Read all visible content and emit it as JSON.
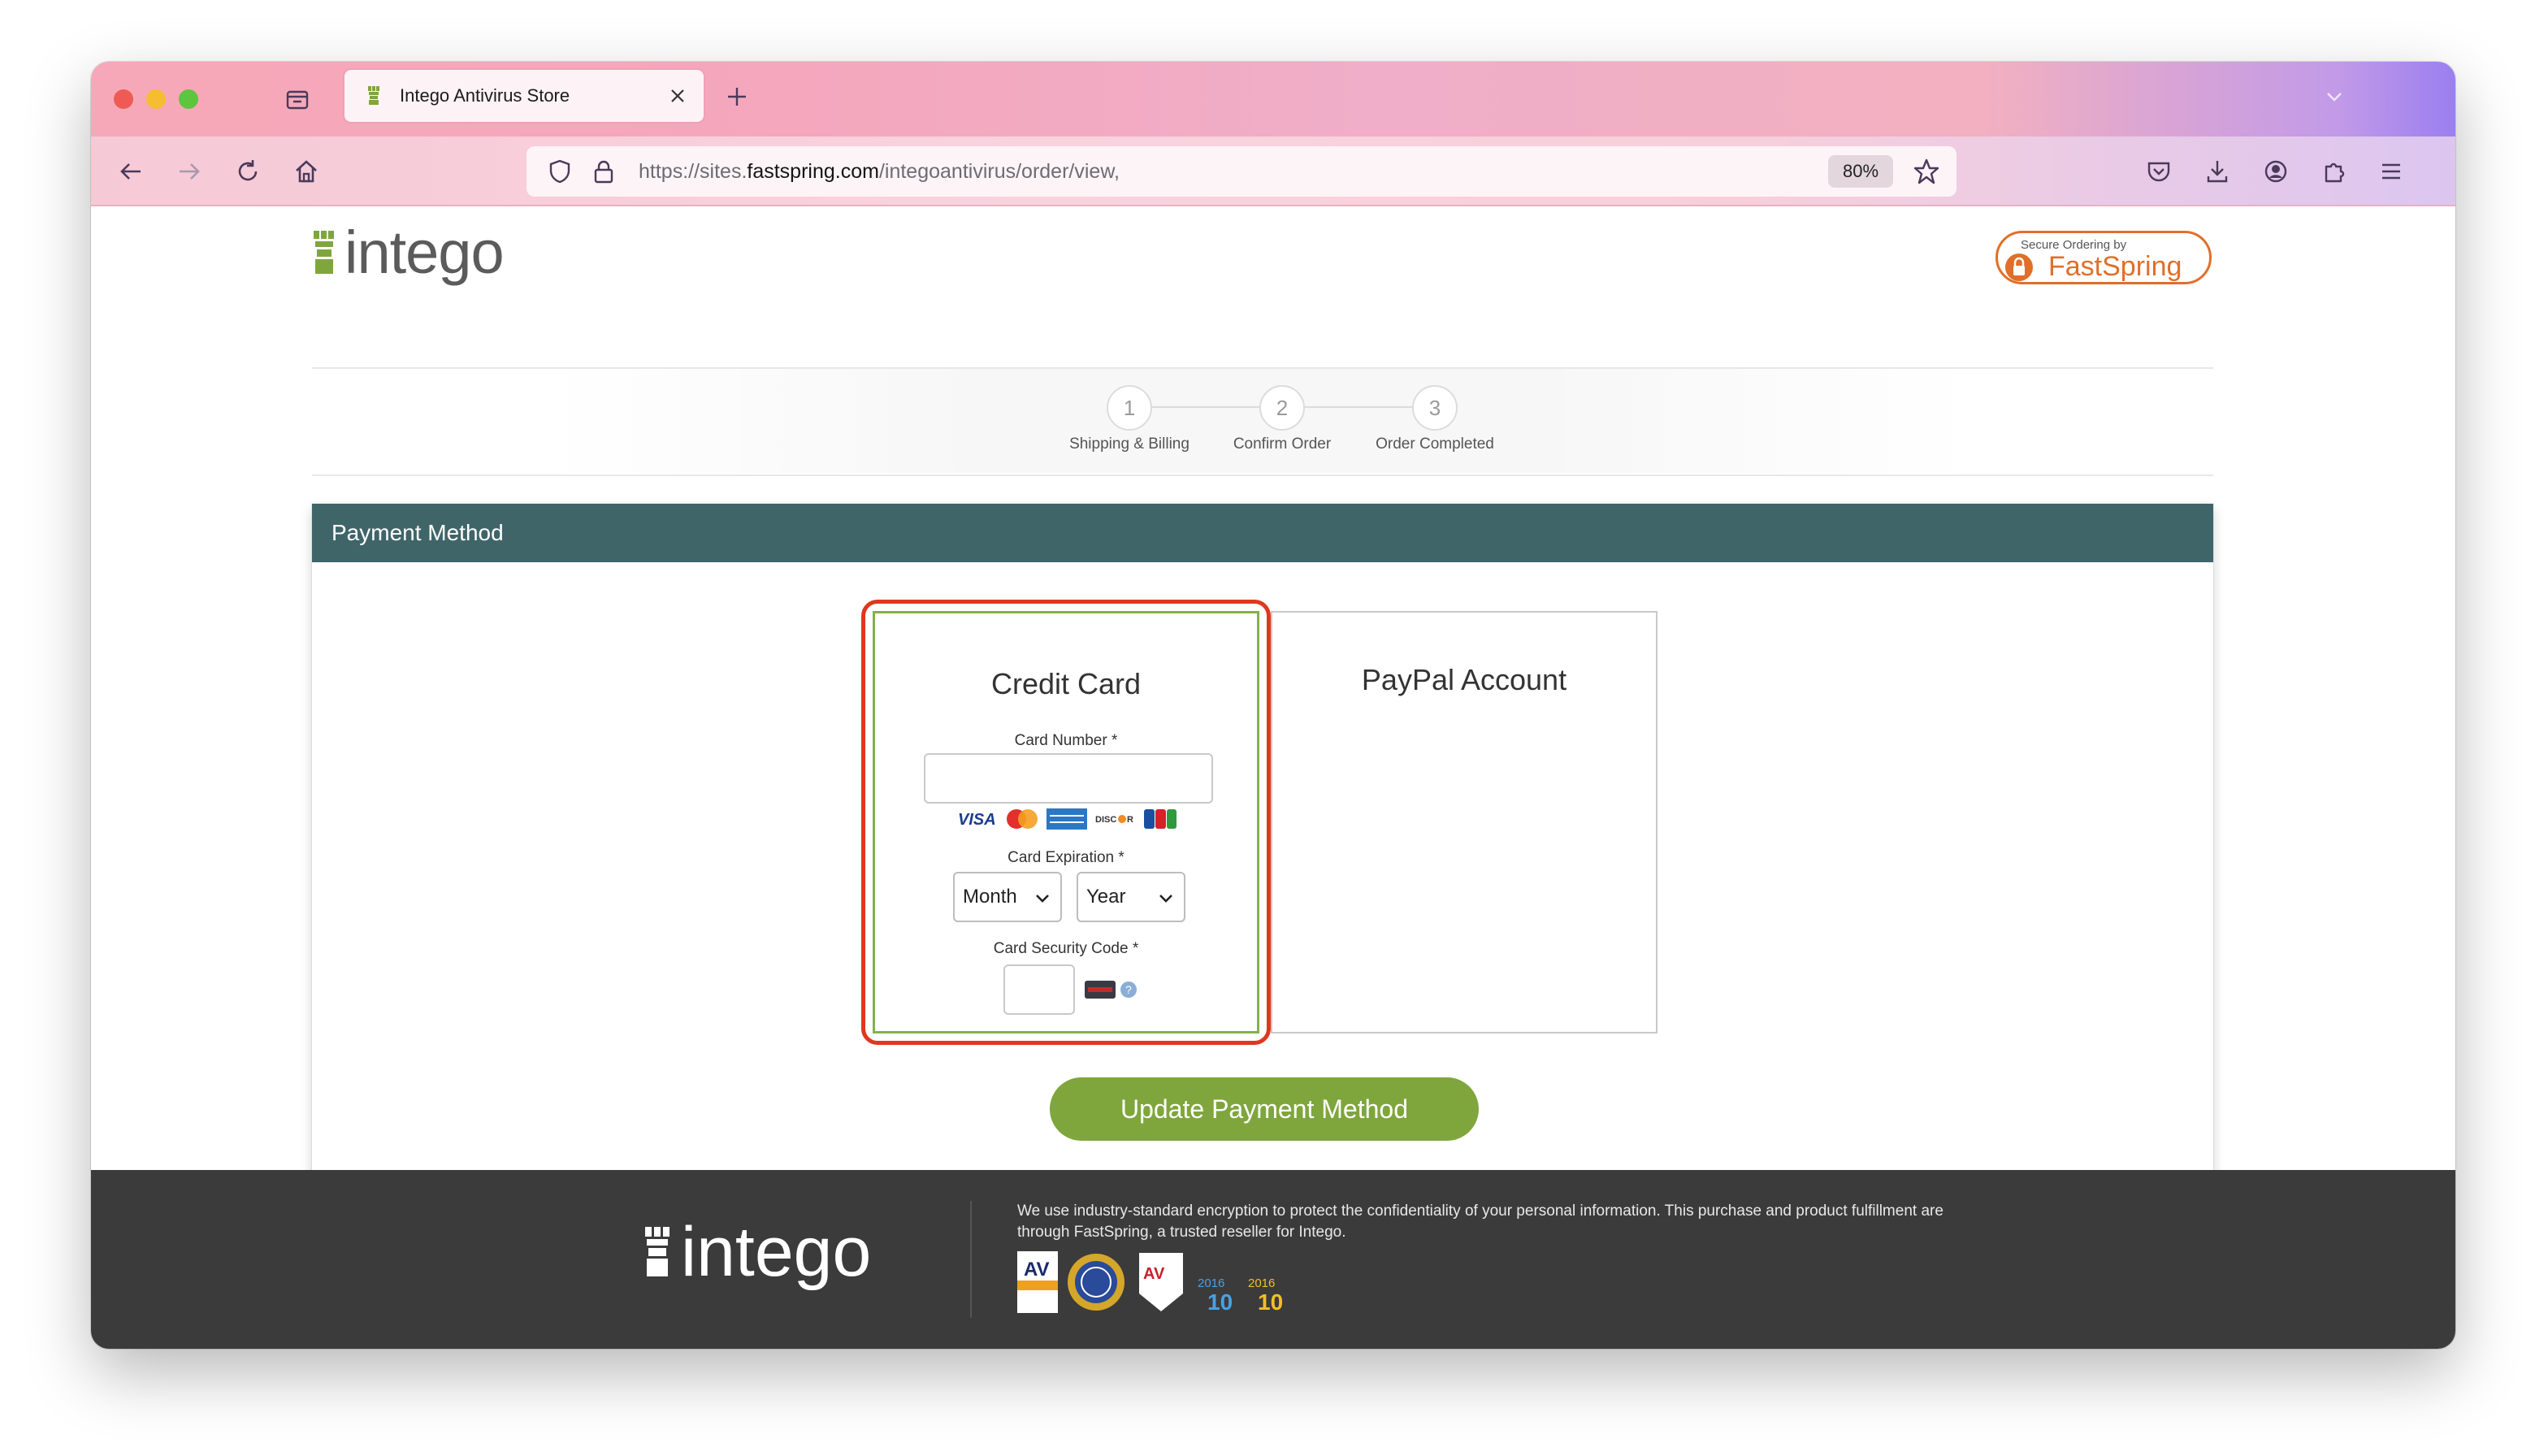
{
  "browser": {
    "tab_title": "Intego Antivirus Store",
    "url_prefix": "https://sites.",
    "url_host": "fastspring.com",
    "url_path": "/integoantivirus/order/view,",
    "zoom": "80%"
  },
  "header": {
    "logo_text": "intego",
    "fastspring_small": "Secure Ordering by",
    "fastspring_big": "FastSpring"
  },
  "steps": [
    {
      "number": "1",
      "label": "Shipping & Billing"
    },
    {
      "number": "2",
      "label": "Confirm Order"
    },
    {
      "number": "3",
      "label": "Order Completed"
    }
  ],
  "payment": {
    "heading": "Payment Method",
    "credit_card": {
      "title": "Credit Card",
      "card_number_label": "Card Number",
      "expiration_label": "Card Expiration",
      "month_value": "Month",
      "year_value": "Year",
      "slash": "/",
      "security_code_label": "Card Security Code",
      "required_mark": "*",
      "brands": [
        "VISA",
        "MasterCard",
        "AMERICAN EXPRESS",
        "DISCOVER",
        "JCB"
      ]
    },
    "paypal": {
      "title": "PayPal Account"
    },
    "submit_label": "Update Payment Method"
  },
  "footer": {
    "logo_text": "intego",
    "text": "We use industry-standard encryption to protect the confidentiality of your personal information. This purchase and product fulfillment are through FastSpring, a trusted reseller for Intego.",
    "badges": [
      "AV",
      "AV-TEST",
      "2016",
      "2016"
    ]
  },
  "colors": {
    "panel_header": "#3f6569",
    "accent_green": "#7fa63c",
    "highlight_red": "#e0371f",
    "footer_bg": "#3b3b3b"
  }
}
